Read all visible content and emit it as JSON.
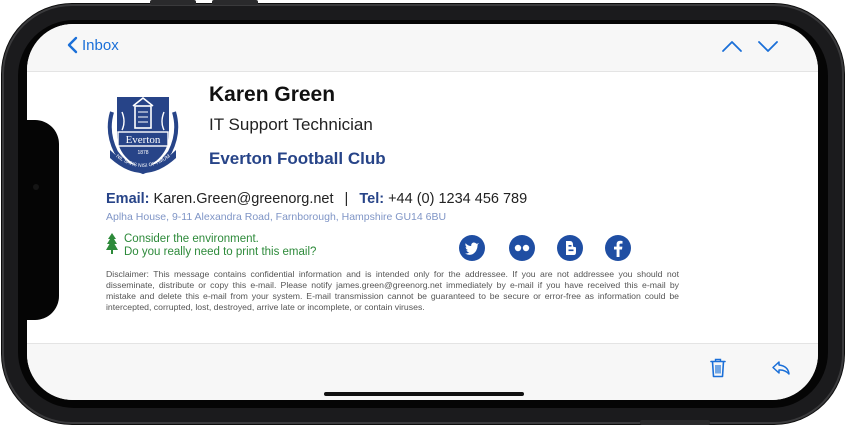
{
  "nav": {
    "back_label": "Inbox"
  },
  "signature": {
    "name": "Karen Green",
    "role": "IT Support Technician",
    "club": "Everton Football Club",
    "email_label": "Email:",
    "email": "Karen.Green@greenorg.net",
    "separator": "|",
    "tel_label": "Tel:",
    "tel": "+44 (0) 1234 456 789",
    "address": "Aplha House, 9-11 Alexandra Road, Farnborough, Hampshire GU14 6BU",
    "env_line1": "Consider the environment.",
    "env_line2": "Do you really need to print this email?",
    "disclaimer": "Disclaimer: This message contains confidential information and is intended only for the addressee. If you are not addressee you should not disseminate, distribute or copy this e-mail. Please notify james.green@greenorg.net immediately by e-mail if you have received this e-mail by mistake and delete this e-mail from your system. E-mail transmission cannot be guaranteed to be secure or error-free as information could be intercepted, corrupted, lost, destroyed, arrive late or incomplete, or contain viruses."
  },
  "crest": {
    "name_text": "Everton",
    "year": "1878",
    "motto": "NIL SATIS NISI OPTIMUM"
  },
  "social": [
    "twitter-icon",
    "flickr-icon",
    "blogger-icon",
    "facebook-icon"
  ],
  "colors": {
    "accent": "#1a6fd8",
    "club_blue": "#274488",
    "env_green": "#2d8a3a",
    "address_blue": "#7f95c6"
  }
}
